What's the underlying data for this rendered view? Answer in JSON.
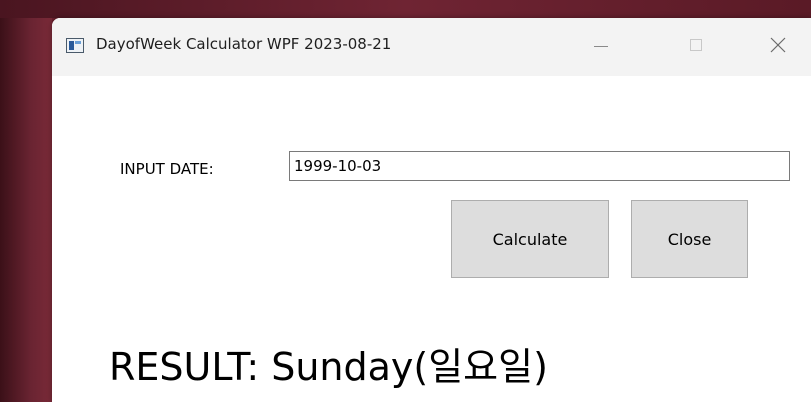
{
  "window": {
    "title": "DayofWeek Calculator WPF 2023-08-21"
  },
  "form": {
    "input_label": "INPUT DATE:",
    "date_value": "1999-10-03",
    "calculate_label": "Calculate",
    "close_label": "Close"
  },
  "result": {
    "text": "RESULT: Sunday(일요일)"
  },
  "icons": {
    "app": "app-window-icon",
    "minimize": "minimize-icon",
    "maximize": "maximize-icon",
    "close": "close-icon"
  }
}
